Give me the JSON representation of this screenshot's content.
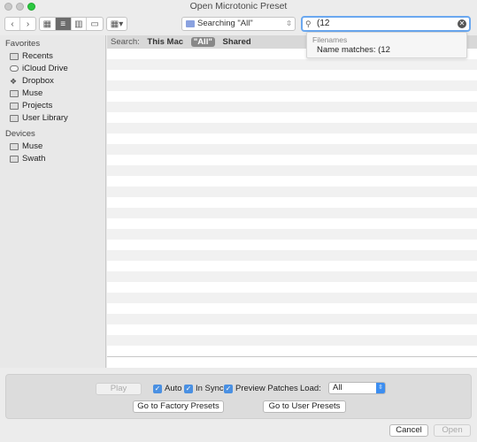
{
  "window": {
    "title": "Open Microtonic Preset"
  },
  "toolbar": {
    "back_glyph": "‹",
    "forward_glyph": "›",
    "scope_label": "Searching \"All\"",
    "search_value": "(12"
  },
  "sidebar": {
    "favorites_heading": "Favorites",
    "favorites": [
      {
        "label": "Recents",
        "icon": "recents-icon"
      },
      {
        "label": "iCloud Drive",
        "icon": "cloud-icon"
      },
      {
        "label": "Dropbox",
        "icon": "dropbox-icon"
      },
      {
        "label": "Muse",
        "icon": "folder-icon"
      },
      {
        "label": "Projects",
        "icon": "folder-icon"
      },
      {
        "label": "User Library",
        "icon": "folder-icon"
      }
    ],
    "devices_heading": "Devices",
    "devices": [
      {
        "label": "Muse",
        "icon": "drive-icon"
      },
      {
        "label": "Swath",
        "icon": "drive-icon"
      }
    ]
  },
  "scopebar": {
    "search_label": "Search:",
    "this_mac": "This Mac",
    "all": "\"All\"",
    "shared": "Shared"
  },
  "suggestions": {
    "section": "Filenames",
    "item": "Name matches: (12"
  },
  "accessory": {
    "play": "Play",
    "auto": "Auto",
    "in_sync": "In Sync",
    "preview_patches": "Preview Patches",
    "load_label": "Load:",
    "load_value": "All",
    "factory": "Go to Factory Presets",
    "user": "Go to User Presets"
  },
  "footer": {
    "cancel": "Cancel",
    "open": "Open"
  },
  "colors": {
    "accent": "#4a90e2",
    "zoom": "#2bc840"
  }
}
